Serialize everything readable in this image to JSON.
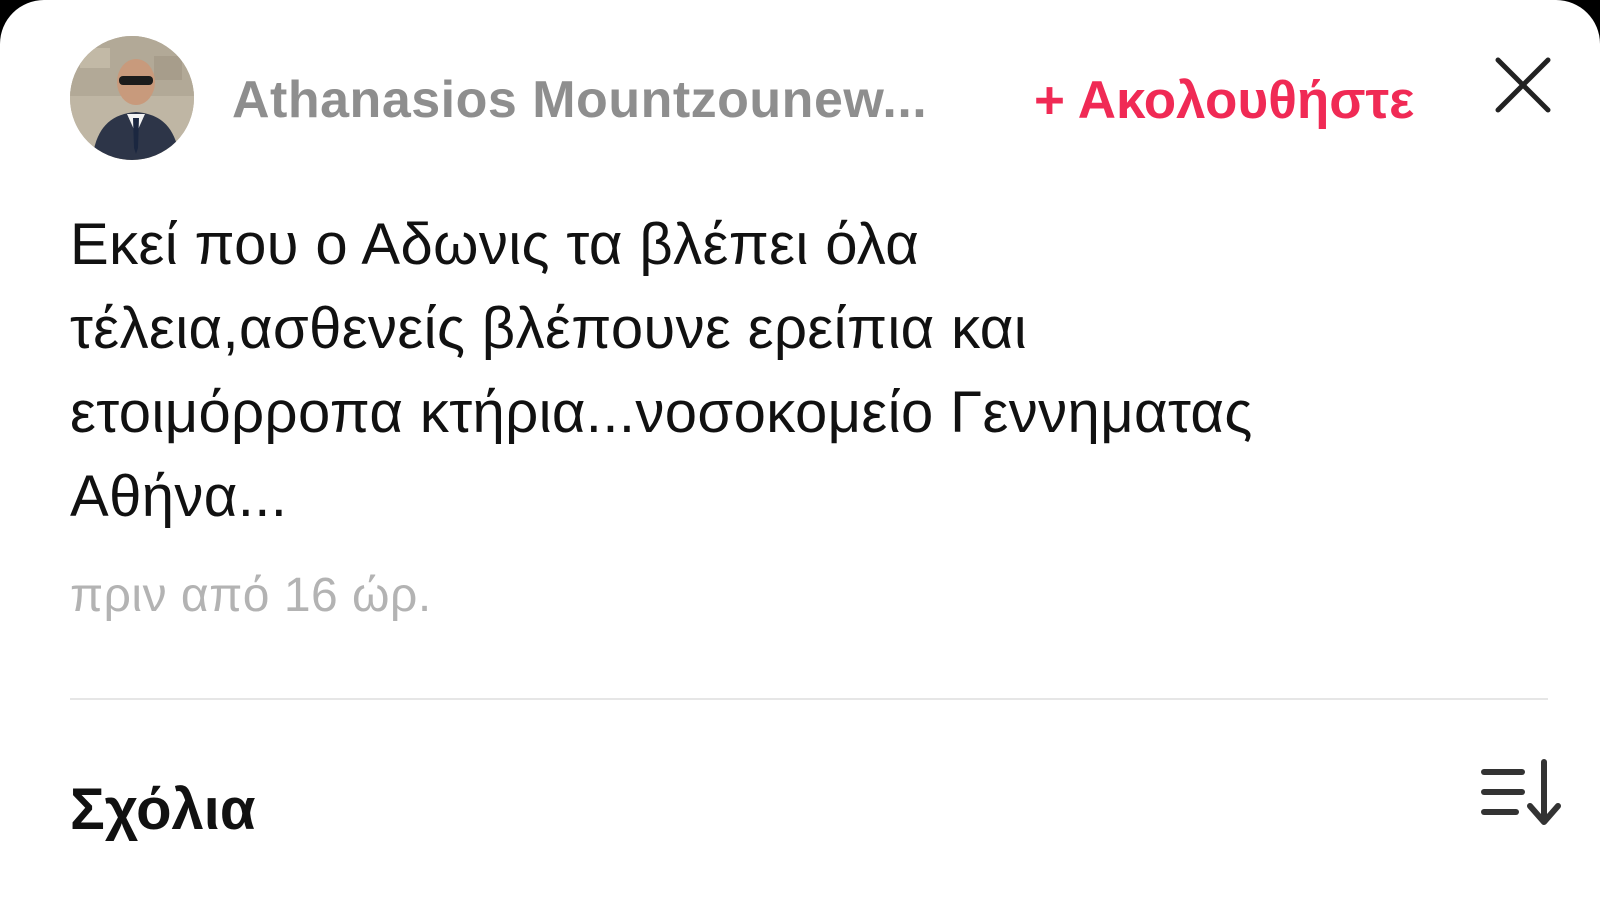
{
  "header": {
    "username": "Athanasios Mountzounew...",
    "follow_label": "+ Ακολουθήστε",
    "avatar_icon": "profile-photo",
    "close_icon": "close-icon"
  },
  "post": {
    "text": "Εκεί που ο Αδωνις τα βλέπει όλα\nτέλεια,ασθενείς βλέπουνε ερείπια και\nετοιμόρροπα κτήρια...νοσοκομείο Γεννηματας\nΑθήνα...",
    "timestamp": "πριν από 16 ώρ."
  },
  "comments": {
    "title": "Σχόλια",
    "sort_icon": "sort-icon"
  },
  "colors": {
    "accent": "#f02a55",
    "username": "#8e8e8e",
    "timestamp": "#b3b3b3",
    "text": "#111111"
  }
}
